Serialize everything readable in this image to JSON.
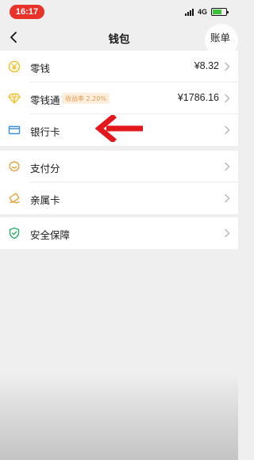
{
  "status_bar": {
    "time": "16:17",
    "network": "4G",
    "battery_level": 0.7
  },
  "nav": {
    "title": "钱包",
    "right_label": "账单"
  },
  "wallet_group": [
    {
      "label": "零钱",
      "value": "¥8.32",
      "icon": "yuan-coin-icon"
    },
    {
      "label": "零钱通",
      "badge": "收益率 2.20%",
      "value": "¥1786.16",
      "icon": "diamond-icon"
    },
    {
      "label": "银行卡",
      "icon": "bank-card-icon"
    }
  ],
  "services_group": [
    {
      "label": "支付分",
      "icon": "score-badge-icon"
    },
    {
      "label": "亲属卡",
      "icon": "family-card-icon"
    }
  ],
  "security_group": [
    {
      "label": "安全保障",
      "icon": "shield-icon"
    }
  ],
  "colors": {
    "time_pill": "#e8322a",
    "accent_gold": "#f2c230",
    "accent_blue": "#3a8fdc",
    "accent_orange": "#e9a13b",
    "accent_green": "#2aae67",
    "pointer_arrow": "#e3171c"
  }
}
